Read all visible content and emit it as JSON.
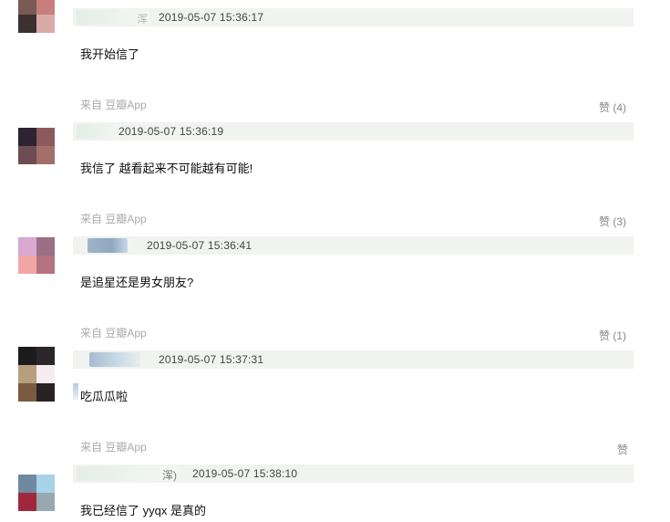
{
  "comments": [
    {
      "name_fragment": "浑",
      "timestamp": "2019-05-07 15:36:17",
      "text": "我开始信了",
      "source": "来自 豆瓣App",
      "like_label": "赞 (4)",
      "avatar_colors": [
        "#7a5a52",
        "#c87e7a",
        "#3b3230",
        "#d9aaa6"
      ]
    },
    {
      "name_fragment": "",
      "timestamp": "2019-05-07 15:36:19",
      "text": "我信了 越看起来不可能越有可能!",
      "source": "来自 豆瓣App",
      "like_label": "赞 (3)",
      "avatar_colors": [
        "#2e2330",
        "#8c5a5d",
        "#6b4d52",
        "#a36f6a"
      ]
    },
    {
      "name_fragment": "",
      "timestamp": "2019-05-07 15:36:41",
      "text": "是追星还是男女朋友?",
      "source": "来自 豆瓣App",
      "like_label": "赞 (1)",
      "avatar_colors": [
        "#d9a9d4",
        "#9c6f86",
        "#f1a6a6",
        "#b5737f"
      ]
    },
    {
      "name_fragment": "",
      "timestamp": "2019-05-07 15:37:31",
      "text": "吃瓜瓜啦",
      "source": "来自 豆瓣App",
      "like_label": "赞",
      "avatar_colors": [
        "#1d1c1c",
        "#2b2728",
        "#b79f7e",
        "#f6ecee",
        "#7a5a40",
        "#2a2222"
      ]
    },
    {
      "name_fragment": "浑)",
      "timestamp": "2019-05-07 15:38:10",
      "text": "我已经信了 yyqx 是真的",
      "source": "",
      "like_label": "",
      "avatar_colors": [
        "#6f8aa0",
        "#a8d2e6",
        "#a0283c",
        "#98a8b0"
      ]
    }
  ]
}
